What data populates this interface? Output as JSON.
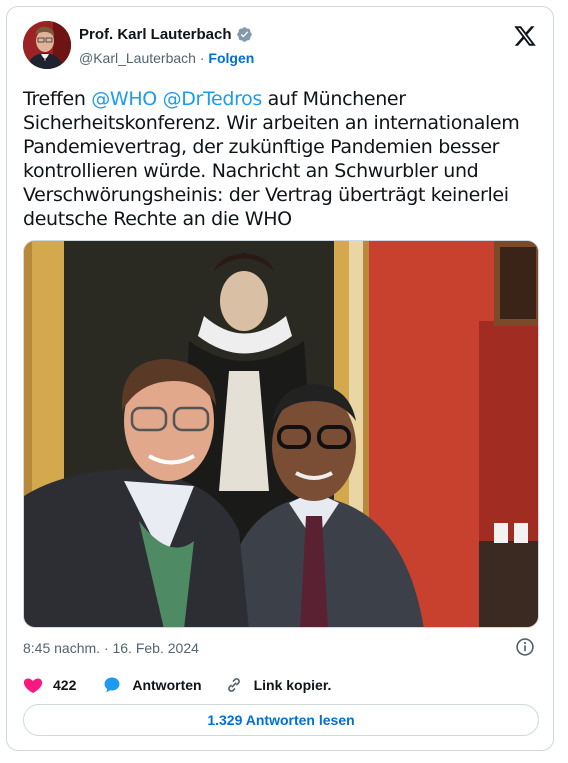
{
  "author": {
    "name": "Prof. Karl Lauterbach",
    "handle": "@Karl_Lauterbach",
    "separator": "·",
    "follow_label": "Folgen"
  },
  "tweet": {
    "segments": [
      {
        "text": "Treffen ",
        "type": "text"
      },
      {
        "text": "@WHO",
        "type": "mention"
      },
      {
        "text": " ",
        "type": "text"
      },
      {
        "text": "@DrTedros",
        "type": "mention"
      },
      {
        "text": " auf Münchener Sicherheitskonferenz. Wir arbeiten an internationalem Pandemievertrag, der zukünftige Pandemien besser kontrollieren würde. Nachricht an Schwurbler und Verschwörungsheinis: der Vertrag überträgt keinerlei deutsche Rechte an die WHO",
        "type": "text"
      }
    ],
    "timestamp": "8:45 nachm. · 16. Feb. 2024"
  },
  "actions": {
    "likes": "422",
    "reply_label": "Antworten",
    "copy_link_label": "Link kopier."
  },
  "read_replies_label": "1.329 Antworten lesen",
  "colors": {
    "mention": "#1d9bf0",
    "like": "#f91880",
    "reply": "#1d9bf0",
    "follow": "#006fd6"
  },
  "icons": [
    "verified-badge-icon",
    "x-logo-icon",
    "info-icon",
    "heart-icon",
    "reply-bubble-icon",
    "link-icon"
  ]
}
